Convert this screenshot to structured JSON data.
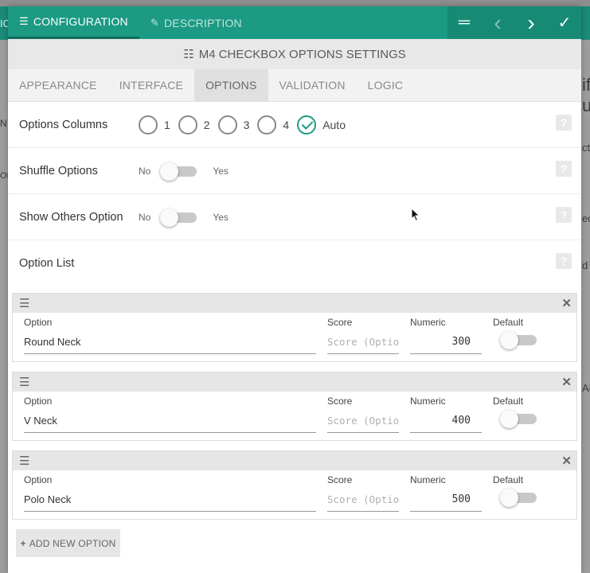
{
  "background": {
    "top_left_fragment": "IC",
    "left_fragment_1": "N",
    "left_fragment_2": "ON",
    "right_fragment_1": "if",
    "right_fragment_2": "u",
    "right_fragment_3": "ct",
    "right_fragment_4": "ec",
    "right_fragment_5": "d",
    "right_fragment_6": "AD"
  },
  "topbar": {
    "tabs": [
      {
        "label": "CONFIGURATION",
        "icon": "list-icon",
        "active": true
      },
      {
        "label": "DESCRIPTION",
        "icon": "feather-icon",
        "active": false
      }
    ],
    "actions": [
      {
        "icon": "drag-handle-icon",
        "glyph": "═"
      },
      {
        "icon": "chevron-left-icon",
        "glyph": "‹"
      },
      {
        "icon": "chevron-right-icon",
        "glyph": "›"
      },
      {
        "icon": "check-icon",
        "glyph": "✓"
      }
    ]
  },
  "title": "M4 CHECKBOX OPTIONS SETTINGS",
  "subtabs": [
    {
      "label": "APPEARANCE",
      "active": false
    },
    {
      "label": "INTERFACE",
      "active": false
    },
    {
      "label": "OPTIONS",
      "active": true
    },
    {
      "label": "VALIDATION",
      "active": false
    },
    {
      "label": "LOGIC",
      "active": false
    }
  ],
  "settings": {
    "options_columns": {
      "label": "Options Columns",
      "choices": [
        "1",
        "2",
        "3",
        "4",
        "Auto"
      ],
      "selected": "Auto"
    },
    "shuffle": {
      "label": "Shuffle Options",
      "off_label": "No",
      "on_label": "Yes",
      "value": false
    },
    "show_others": {
      "label": "Show Others Option",
      "off_label": "No",
      "on_label": "Yes",
      "value": false
    },
    "option_list_label": "Option List",
    "help_glyph": "?"
  },
  "field_labels": {
    "option": "Option",
    "score": "Score",
    "numeric": "Numeric",
    "default": "Default",
    "score_placeholder": "Score (Optional)"
  },
  "options": [
    {
      "option": "Round Neck",
      "numeric": "300",
      "default": false
    },
    {
      "option": "V Neck",
      "numeric": "400",
      "default": false
    },
    {
      "option": "Polo Neck",
      "numeric": "500",
      "default": false
    }
  ],
  "add_button": "ADD NEW OPTION"
}
